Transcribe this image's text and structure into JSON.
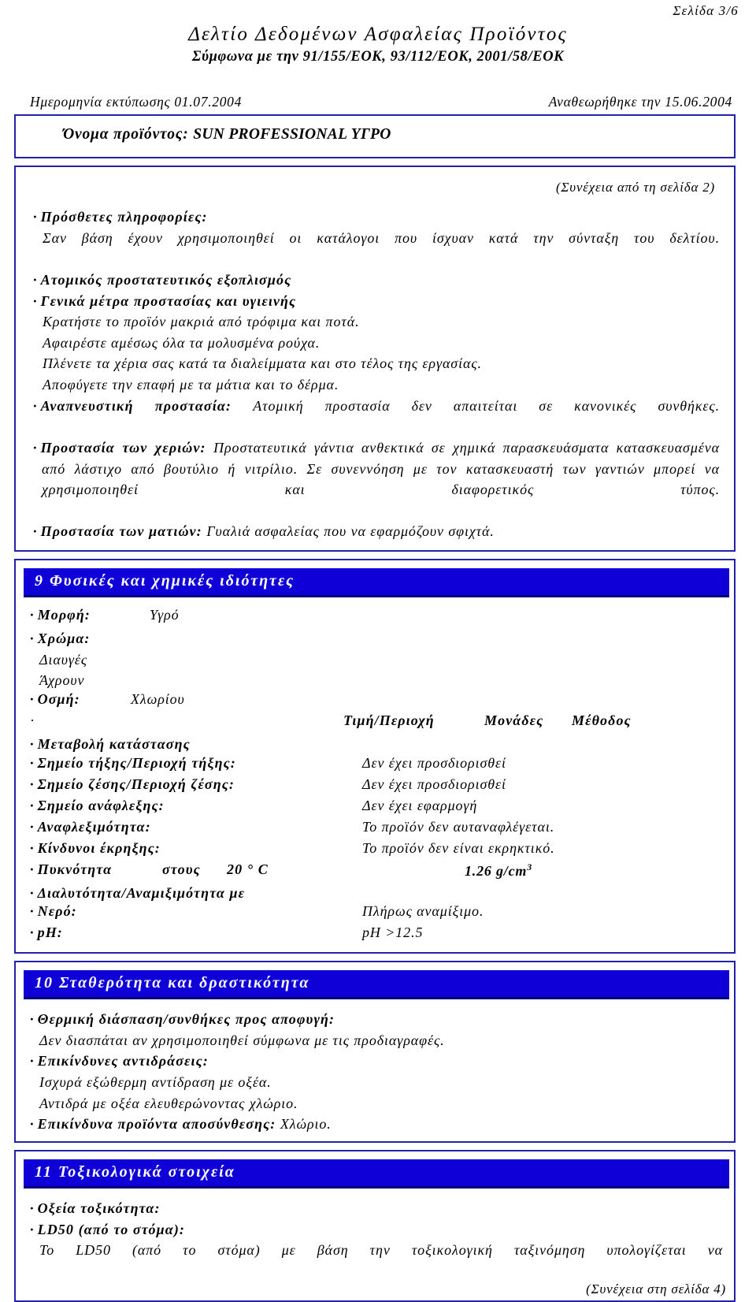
{
  "header": {
    "page_label": "Σελίδα 3/6",
    "title": "Δελτίο Δεδομένων Ασφαλείας Προϊόντος",
    "subtitle": "Σύμφωνα με την 91/155/ΕΟΚ, 93/112/ΕΟΚ, 2001/58/ΕΟΚ",
    "print_date": "Ημερομηνία εκτύπωσης 01.07.2004",
    "revision_date": "Αναθεωρήθηκε την 15.06.2004"
  },
  "product": {
    "label": "Όνομα προϊόντος:",
    "name": "SUN PROFESSIONAL ΥΓΡΟ"
  },
  "continuation": {
    "from_prev": "(Συνέχεια από τη σελίδα 2)",
    "to_next": "(Συνέχεια στη σελίδα 4)"
  },
  "section_ppe": {
    "additional_info_heading": "Πρόσθετες πληροφορίες:",
    "additional_info_text": "Σαν βάση έχουν χρησιμοποιηθεί οι κατάλογοι που ίσχυαν κατά την σύνταξη του δελτίου.",
    "ppe_heading": "Ατομικός προστατευτικός εξοπλισμός",
    "general_heading": "Γενικά μέτρα προστασίας και υγιεινής",
    "general_line1": "Κρατήστε το προϊόν μακριά από τρόφιμα και ποτά.",
    "general_line2": "Αφαιρέστε αμέσως όλα τα μολυσμένα ρούχα.",
    "general_line3": "Πλένετε τα χέρια σας κατά τα διαλείμματα και στο τέλος της εργασίας.",
    "general_line4": "Αποφύγετε την επαφή με τα μάτια και το δέρμα.",
    "respiratory_label": "Αναπνευστική προστασία:",
    "respiratory_value": "Ατομική προστασία δεν απαιτείται σε κανονικές συνθήκες.",
    "hands_label": "Προστασία των χεριών:",
    "hands_value": "Προστατευτικά γάντια ανθεκτικά σε χημικά παρασκευάσματα κατασκευασμένα από λάστιχο από βουτύλιο ή νιτρίλιο. Σε συνεννόηση με τον κατασκευαστή των γαντιών μπορεί να χρησιμοποιηθεί και διαφορετικός τύπος.",
    "eyes_label": "Προστασία των ματιών:",
    "eyes_value": "Γυαλιά ασφαλείας που να εφαρμόζουν σφιχτά."
  },
  "section9": {
    "banner": "9 Φυσικές και χημικές ιδιότητες",
    "form_label": "Μορφή:",
    "form_value": "Υγρό",
    "color_label": "Χρώμα:",
    "color_line1": "Διαυγές",
    "color_line2": "Άχρουν",
    "odor_label": "Οσμή:",
    "odor_value": "Χλωρίου",
    "col_value": "Τιμή/Περιοχή",
    "col_units": "Μονάδες",
    "col_method": "Μέθοδος",
    "state_change": "Μεταβολή κατάστασης",
    "melting_label": "Σημείο τήξης/Περιοχή τήξης:",
    "melting_value": "Δεν έχει προσδιορισθεί",
    "boiling_label": "Σημείο ζέσης/Περιοχή ζέσης:",
    "boiling_value": "Δεν έχει προσδιορισθεί",
    "flash_label": "Σημείο ανάφλεξης:",
    "flash_value": "Δεν έχει εφαρμογή",
    "flammability_label": "Αναφλεξιμότητα:",
    "flammability_value": "Το προϊόν δεν αυταναφλέγεται.",
    "explosion_label": "Κίνδυνοι έκρηξης:",
    "explosion_value": "Το προϊόν δεν είναι εκρηκτικό.",
    "density_label": "Πυκνότητα",
    "density_at": "στους",
    "density_temp": "20 ° C",
    "density_value": "1.26 g/cm",
    "density_exp": "3",
    "solubility_label": "Διαλυτότητα/Αναμιξιμότητα με",
    "water_label": "Νερό:",
    "water_value": "Πλήρως αναμίξιμο.",
    "ph_label": "pH:",
    "ph_value": "pH >12.5"
  },
  "section10": {
    "banner": "10 Σταθερότητα και δραστικότητα",
    "thermal_heading": "Θερμική διάσπαση/συνθήκες προς αποφυγή:",
    "thermal_text": "Δεν διασπάται αν χρησιμοποιηθεί σύμφωνα με τις προδιαγραφές.",
    "reactions_heading": "Επικίνδυνες αντιδράσεις:",
    "reactions_line1": "Ισχυρά εξώθερμη αντίδραση με οξέα.",
    "reactions_line2": "Αντιδρά με οξέα ελευθερώνοντας χλώριο.",
    "decomposition_label": "Επικίνδυνα προϊόντα αποσύνθεσης:",
    "decomposition_value": "Χλώριο."
  },
  "section11": {
    "banner": "11 Τοξικολογικά στοιχεία",
    "acute_heading": "Οξεία τοξικότητα:",
    "ld50_heading": "LD50 (από το στόμα):",
    "ld50_text": "Το LD50 (από το στόμα) με βάση την τοξικολογική ταξινόμηση υπολογίζεται να"
  },
  "colors": {
    "banner_blue": "#1000d8",
    "banner_edge": "#00007a",
    "border_blue": "#2222aa"
  }
}
